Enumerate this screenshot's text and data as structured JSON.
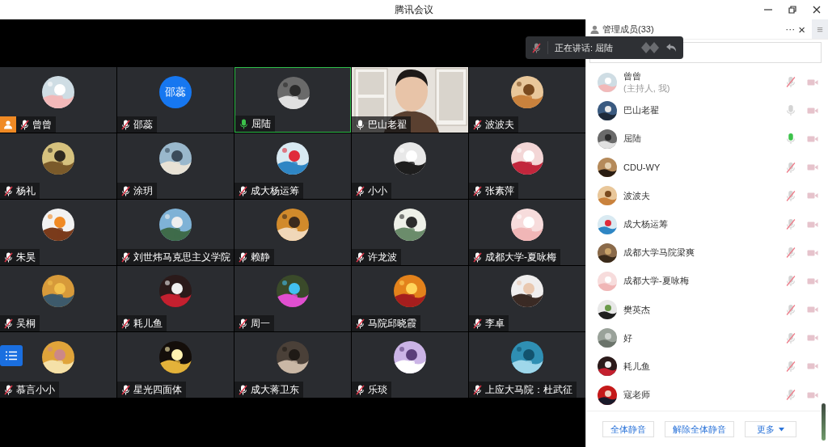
{
  "window": {
    "title": "腾讯会议"
  },
  "speaking_toast": {
    "text": "正在讲话: 屈陆"
  },
  "tiles": [
    {
      "name": "曾曾",
      "kind": "avatar",
      "muted": true,
      "speaking": false,
      "selected": false,
      "host": true
    },
    {
      "name": "邵蕊",
      "kind": "initials",
      "initials": "邵蕊",
      "muted": true,
      "speaking": false,
      "selected": false,
      "host": false
    },
    {
      "name": "屈陆",
      "kind": "avatar",
      "muted": false,
      "speaking": true,
      "selected": true,
      "host": false
    },
    {
      "name": "巴山老翟",
      "kind": "video",
      "muted": false,
      "speaking": false,
      "selected": false,
      "host": false
    },
    {
      "name": "波波夫",
      "kind": "avatar",
      "muted": true,
      "speaking": false,
      "selected": false,
      "host": false
    },
    {
      "name": "杨礼",
      "kind": "avatar",
      "muted": true,
      "speaking": false,
      "selected": false,
      "host": false
    },
    {
      "name": "涂玥",
      "kind": "avatar",
      "muted": true,
      "speaking": false,
      "selected": false,
      "host": false
    },
    {
      "name": "成大杨运筹",
      "kind": "avatar",
      "muted": true,
      "speaking": false,
      "selected": false,
      "host": false
    },
    {
      "name": "小小",
      "kind": "avatar",
      "muted": true,
      "speaking": false,
      "selected": false,
      "host": false
    },
    {
      "name": "张素萍",
      "kind": "avatar",
      "muted": true,
      "speaking": false,
      "selected": false,
      "host": false
    },
    {
      "name": "朱昊",
      "kind": "avatar",
      "muted": true,
      "speaking": false,
      "selected": false,
      "host": false
    },
    {
      "name": "刘世炜马克思主义学院",
      "kind": "avatar",
      "muted": true,
      "speaking": false,
      "selected": false,
      "host": false
    },
    {
      "name": "赖静",
      "kind": "avatar",
      "muted": true,
      "speaking": false,
      "selected": false,
      "host": false
    },
    {
      "name": "许龙波",
      "kind": "avatar",
      "muted": true,
      "speaking": false,
      "selected": false,
      "host": false
    },
    {
      "name": "成都大学-夏咏梅",
      "kind": "avatar",
      "muted": true,
      "speaking": false,
      "selected": false,
      "host": false
    },
    {
      "name": "吴桐",
      "kind": "avatar",
      "muted": true,
      "speaking": false,
      "selected": false,
      "host": false
    },
    {
      "name": "耗儿鱼",
      "kind": "avatar",
      "muted": true,
      "speaking": false,
      "selected": false,
      "host": false
    },
    {
      "name": "周一",
      "kind": "avatar",
      "muted": true,
      "speaking": false,
      "selected": false,
      "host": false
    },
    {
      "name": "马院邱晓霞",
      "kind": "avatar",
      "muted": true,
      "speaking": false,
      "selected": false,
      "host": false
    },
    {
      "name": "李卓",
      "kind": "avatar",
      "muted": true,
      "speaking": false,
      "selected": false,
      "host": false
    },
    {
      "name": "慕言小小",
      "kind": "avatar",
      "muted": true,
      "speaking": false,
      "selected": false,
      "host": false
    },
    {
      "name": "星光四面体",
      "kind": "avatar",
      "muted": true,
      "speaking": false,
      "selected": false,
      "host": false
    },
    {
      "name": "成大蒋卫东",
      "kind": "avatar",
      "muted": true,
      "speaking": false,
      "selected": false,
      "host": false
    },
    {
      "name": "乐琰",
      "kind": "avatar",
      "muted": true,
      "speaking": false,
      "selected": false,
      "host": false
    },
    {
      "name": "上应大马院：杜武征",
      "kind": "avatar",
      "muted": true,
      "speaking": false,
      "selected": false,
      "host": false
    }
  ],
  "panel": {
    "title": "管理成员(33)",
    "more": "···",
    "close": "×",
    "menu": "≡",
    "members": [
      {
        "name": "曾曾",
        "subtitle": "(主持人, 我)",
        "muted": true,
        "speaking": false,
        "camera_on": false
      },
      {
        "name": "巴山老翟",
        "muted": false,
        "speaking": false,
        "camera_on": false
      },
      {
        "name": "屈陆",
        "muted": false,
        "speaking": true,
        "camera_on": false
      },
      {
        "name": "CDU-WY",
        "muted": true,
        "speaking": false,
        "camera_on": false
      },
      {
        "name": "波波夫",
        "muted": true,
        "speaking": false,
        "camera_on": false
      },
      {
        "name": "成大杨运筹",
        "muted": true,
        "speaking": false,
        "camera_on": false
      },
      {
        "name": "成都大学马院梁爽",
        "muted": true,
        "speaking": false,
        "camera_on": false
      },
      {
        "name": "成都大学-夏咏梅",
        "muted": true,
        "speaking": false,
        "camera_on": false
      },
      {
        "name": "樊英杰",
        "muted": true,
        "speaking": false,
        "camera_on": false
      },
      {
        "name": "好",
        "muted": true,
        "speaking": false,
        "camera_on": false
      },
      {
        "name": "耗儿鱼",
        "muted": true,
        "speaking": false,
        "camera_on": false
      },
      {
        "name": "寇老师",
        "muted": true,
        "speaking": false,
        "camera_on": false
      }
    ],
    "buttons": [
      {
        "label": "全体静音",
        "kind": "plain"
      },
      {
        "label": "解除全体静音",
        "kind": "plain"
      },
      {
        "label": "更多",
        "kind": "dropdown"
      }
    ]
  }
}
